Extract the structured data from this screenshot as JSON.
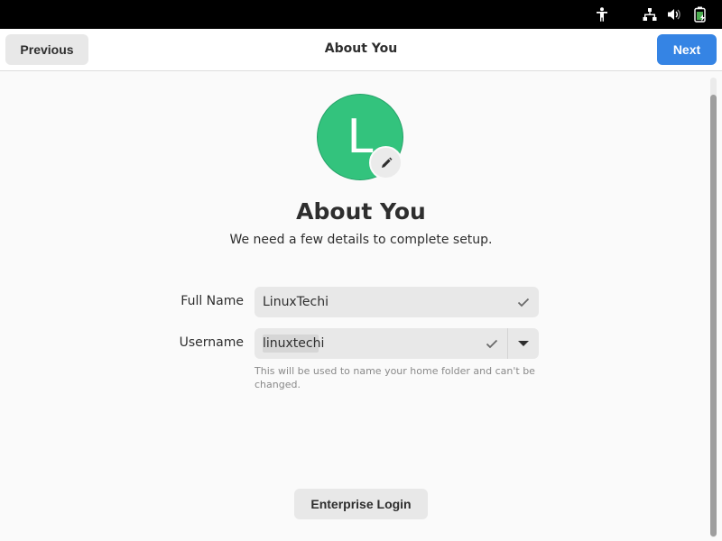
{
  "system_tray": {
    "icons": [
      "accessibility-icon",
      "network-wired-icon",
      "volume-icon",
      "battery-charging-icon"
    ]
  },
  "header": {
    "previous_label": "Previous",
    "title": "About You",
    "next_label": "Next"
  },
  "avatar": {
    "initial": "L",
    "color": "#33c37d"
  },
  "page": {
    "title": "About You",
    "subtitle": "We need a few details to complete setup."
  },
  "form": {
    "full_name": {
      "label": "Full Name",
      "value": "LinuxTechi"
    },
    "username": {
      "label": "Username",
      "value": "linuxtechi",
      "hint": "This will be used to name your home folder and can't be changed."
    }
  },
  "footer": {
    "enterprise_login_label": "Enterprise Login"
  },
  "colors": {
    "accent": "#3584e4"
  }
}
